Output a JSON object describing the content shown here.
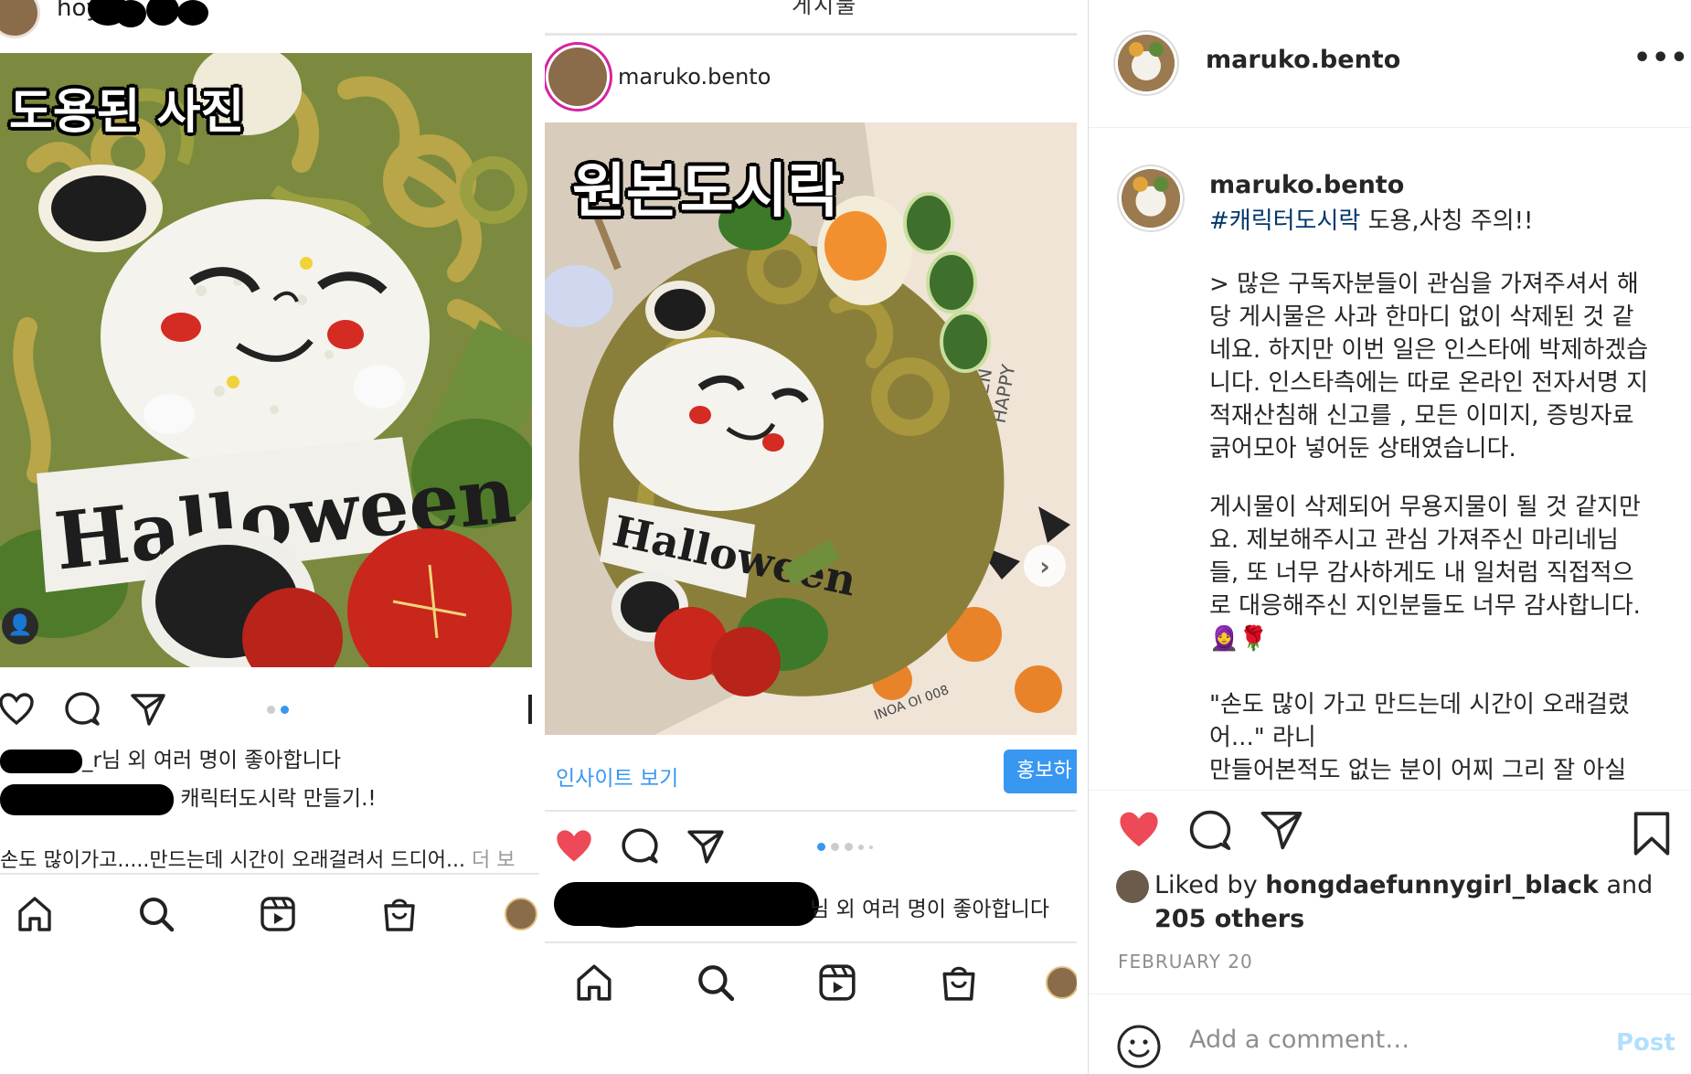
{
  "panel1": {
    "username": "hoyo",
    "overlay_label": "도용된 사진",
    "likes_suffix": "_r님 외 여러 명이 좋아합니다",
    "caption": "캐릭터도시락 만들기.!",
    "comment": "손도 많이가고.....만드는데 시간이 오래걸려서 드디어...",
    "more": "더 보",
    "halloween_text": "Halloween"
  },
  "panel2": {
    "top_text": "게시물",
    "username": "maruko.bento",
    "overlay_label": "원본도시락",
    "insights_label": "인사이트 보기",
    "promote_label": "홍보하",
    "likes_suffix": "님 외 여러 명이 좋아합니다",
    "halloween_text": "Halloween",
    "paper_text_1": "HALLOWEEN",
    "paper_text_2": "HAPPY",
    "paper_text_3": "INOA OI 008"
  },
  "panel3": {
    "username": "maruko.bento",
    "more_label": "•••",
    "caption_user": "maruko.bento",
    "hashtag": "#캐릭터도시락",
    "caption_rest": " 도용,사칭 주의!!",
    "para1": [
      "> 많은 구독자분들이 관심을 가져주셔서 해",
      "당 게시물은 사과 한마디 없이 삭제된 것 같",
      "네요. 하지만 이번 일은 인스타에 박제하겠습",
      "니다. 인스타측에는 따로 온라인 전자서명 지",
      "적재산침해 신고를 , 모든 이미지, 증빙자료",
      "긁어모아 넣어둔 상태였습니다."
    ],
    "para2": [
      "게시물이 삭제되어 무용지물이 될 것 같지만",
      "요. 제보해주시고 관심 가져주신 마리네님",
      "들, 또 너무 감사하게도 내 일처럼 직접적으",
      "로 대응해주신 지인분들도 너무 감사합니다.",
      "🧕🌹"
    ],
    "para3": [
      "\"손도 많이 가고 만드는데 시간이 오래걸렸",
      "어...\" 라니",
      "만들어본적도 없는 분이 어찌 그리 잘 아실"
    ],
    "liked_by_prefix": "Liked by ",
    "liked_by_user": "hongdaefunnygirl_black",
    "liked_by_suffix": " and",
    "others": "205 others",
    "date": "FEBRUARY 20",
    "comment_placeholder": "Add a comment…",
    "post_label": "Post",
    "colors": {
      "heart": "#ed4956",
      "link": "#00376b",
      "post_disabled": "#b2dffc",
      "blue": "#3897f0"
    }
  }
}
